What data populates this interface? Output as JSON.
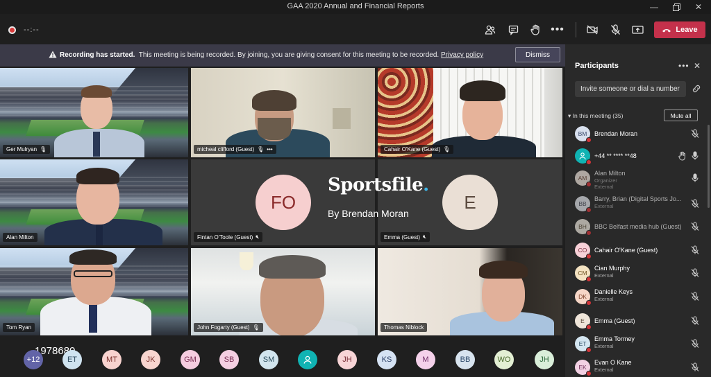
{
  "window": {
    "title": "GAA 2020 Annual and Financial Reports"
  },
  "toolbar": {
    "timer": "--:--",
    "leave_label": "Leave"
  },
  "banner": {
    "bold": "Recording has started.",
    "text": "This meeting is being recorded. By joining, you are giving consent for this meeting to be recorded.",
    "link": "Privacy policy",
    "dismiss_label": "Dismiss"
  },
  "tiles": [
    {
      "name": "Ger Mulryan"
    },
    {
      "name": "micheal clifford (Guest)"
    },
    {
      "name": "Cahair O'Kane (Guest)"
    },
    {
      "name": "Alan Milton"
    },
    {
      "name": "Fintan O'Toole (Guest)",
      "initials": "FO"
    },
    {
      "name": "Emma (Guest)",
      "initials": "E"
    },
    {
      "name": "Tom Ryan"
    },
    {
      "name": "John Fogarty (Guest)"
    },
    {
      "name": "Thomas Niblock"
    }
  ],
  "watermark": {
    "brand": "Sportsfile",
    "byline": "By Brendan Moran",
    "number": "1978680"
  },
  "bottom_avatars": [
    "+12",
    "ET",
    "MT",
    "JK",
    "GM",
    "SB",
    "SM",
    "",
    "JH",
    "KS",
    "M",
    "BB",
    "WO",
    "JH"
  ],
  "participants_panel": {
    "title": "Participants",
    "invite_placeholder": "Invite someone or dial a number",
    "section_label": "In this meeting (35)",
    "mute_all_label": "Mute all",
    "people": [
      {
        "initials": "BM",
        "name": "Brendan Moran",
        "sub": ""
      },
      {
        "initials": "",
        "name": "+44 ** **** **48",
        "sub": ""
      },
      {
        "initials": "AM",
        "name": "Alan Milton",
        "sub": "Organizer",
        "sub2": "External"
      },
      {
        "initials": "BB",
        "name": "Barry, Brian (Digital Sports Jo...",
        "sub": "External"
      },
      {
        "initials": "BH",
        "name": "BBC Belfast media hub (Guest)",
        "sub": ""
      },
      {
        "initials": "CO",
        "name": "Cahair O'Kane (Guest)",
        "sub": ""
      },
      {
        "initials": "CM",
        "name": "Cian Murphy",
        "sub": "External"
      },
      {
        "initials": "DK",
        "name": "Danielle Keys",
        "sub": "External"
      },
      {
        "initials": "E",
        "name": "Emma (Guest)",
        "sub": ""
      },
      {
        "initials": "ET",
        "name": "Emma Tormey",
        "sub": "External"
      },
      {
        "initials": "EK",
        "name": "Evan O Kane",
        "sub": "External"
      }
    ]
  },
  "colors": {
    "leave": "#c4314b",
    "banner": "#3b3a48",
    "accent": "#8b8cc7",
    "panel": "#292929"
  }
}
